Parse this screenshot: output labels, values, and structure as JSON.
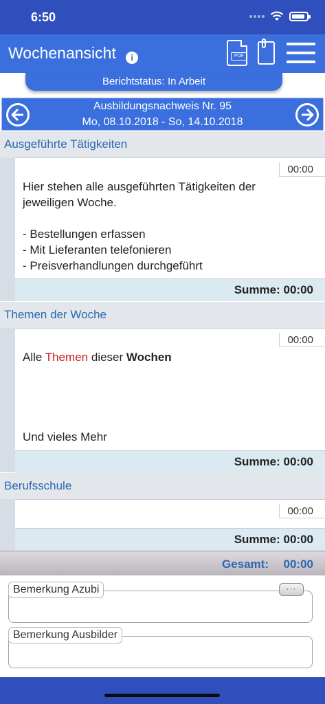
{
  "status_bar": {
    "time": "6:50"
  },
  "header": {
    "title": "Wochenansicht",
    "info_icon": "info-icon",
    "pdf_label": "PDF"
  },
  "report_status": "Berichtstatus: In Arbeit",
  "week": {
    "title": "Ausbildungsnachweis Nr. 95",
    "range": "Mo, 08.10.2018 - So, 14.10.2018"
  },
  "sections": [
    {
      "header": "Ausgeführte Tätigkeiten",
      "time": "00:00",
      "lines": [
        "Hier stehen alle ausgeführten Tätigkeiten der",
        "jeweiligen Woche.",
        "",
        "- Bestellungen erfassen",
        "- Mit Lieferanten telefonieren",
        "- Preisverhandlungen durchgeführt"
      ],
      "sum": "Summe: 00:00"
    },
    {
      "header": "Themen der Woche",
      "time": "00:00",
      "rich": [
        "Alle ",
        "Themen",
        " dieser ",
        "Wochen"
      ],
      "last_line": "Und vieles Mehr",
      "sum": "Summe: 00:00"
    },
    {
      "header": "Berufsschule",
      "time": "00:00",
      "sum": "Summe: 00:00"
    }
  ],
  "total": {
    "label": "Gesamt:",
    "value": "00:00"
  },
  "remarks": {
    "azubi": "Bemerkung Azubi",
    "ausbilder": "Bemerkung Ausbilder",
    "more": "···"
  },
  "colors": {
    "nav_blue": "#3b6fdd",
    "status_blue": "#2f4fbd",
    "section_text": "#2a68b0",
    "highlight_red": "#c51d1d"
  }
}
